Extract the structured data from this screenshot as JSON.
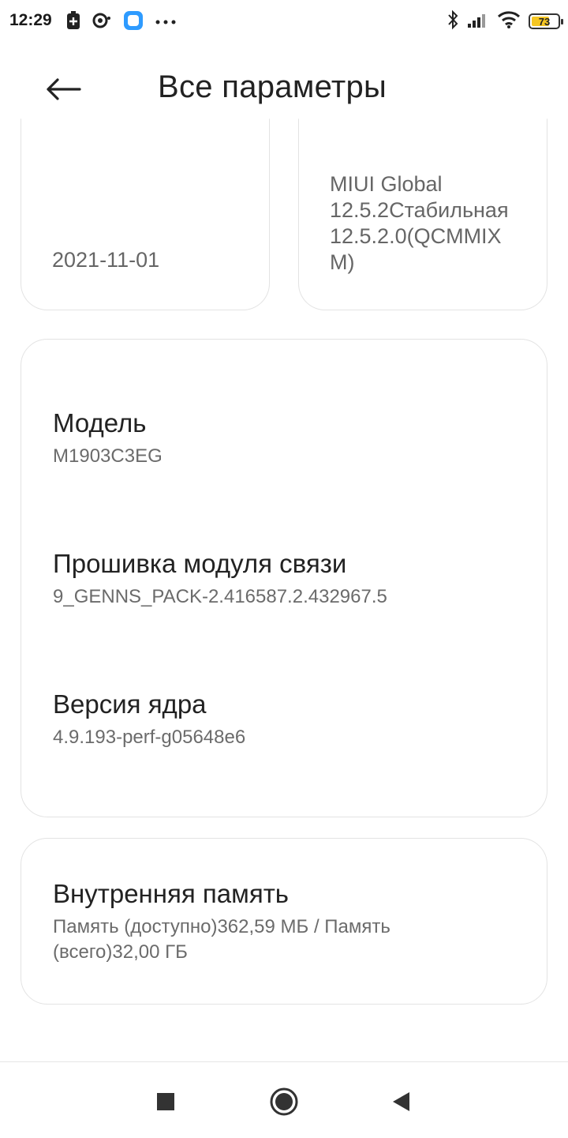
{
  "status_bar": {
    "time": "12:29",
    "left_icons": [
      "battery-saver-icon",
      "sync-icon",
      "app-notification-icon",
      "more-dots-icon"
    ],
    "right_icons": [
      "bluetooth-icon",
      "signal-icon",
      "wifi-icon"
    ],
    "battery_level": "73",
    "battery_color": "#f5c623"
  },
  "header": {
    "title": "Все параметры",
    "back_icon": "arrow-left-icon"
  },
  "top_cards": {
    "left_value": "2021-11-01",
    "right_value": "MIUI Global 12.5.2Стабильная 12.5.2.0(QCMMIX M)"
  },
  "main_card": {
    "items": [
      {
        "title": "Модель",
        "value": "M1903C3EG"
      },
      {
        "title": "Прошивка модуля связи",
        "value": "9_GENNS_PACK-2.416587.2.432967.5"
      },
      {
        "title": "Версия ядра",
        "value": "4.9.193-perf-g05648e6"
      }
    ]
  },
  "storage_card": {
    "title": "Внутренняя память",
    "value": "Память (доступно)362,59 МБ / Память (всего)32,00 ГБ"
  },
  "nav_bar": {
    "icons": [
      "recent-apps-icon",
      "home-icon",
      "back-icon"
    ]
  }
}
